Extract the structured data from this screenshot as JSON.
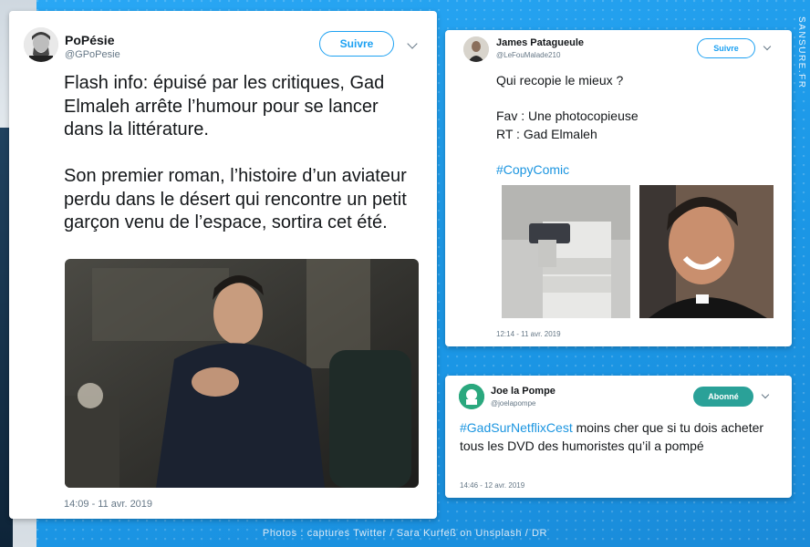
{
  "tweet1": {
    "name": "PoPésie",
    "handle": "@GPoPesie",
    "follow_label": "Suivre",
    "text": "Flash info: épuisé par les critiques, Gad Elmaleh arrête l’humour pour se lancer dans la littérature.\n\nSon premier roman, l’histoire d’un aviateur perdu dans le désert qui rencontre un petit garçon venu de l’espace, sortira cet été.",
    "timestamp": "14:09 - 11 avr. 2019"
  },
  "tweet2": {
    "name": "James Patagueule",
    "handle": "@LeFouMalade210",
    "follow_label": "Suivre",
    "text": "Qui recopie le mieux ?\n\nFav : Une photocopieuse\nRT :  Gad Elmaleh\n\n",
    "hashtag": "#CopyComic",
    "timestamp": "12:14 - 11 avr. 2019"
  },
  "tweet3": {
    "name": "Joe la Pompe",
    "handle": "@joelapompe",
    "follow_label": "Abonné",
    "hashtag": "#GadSurNetflixCest",
    "text": " moins cher que si tu dois acheter tous les DVD des humoristes qu’il a pompé",
    "timestamp": "14:46 - 12 avr. 2019"
  },
  "credit": "Photos : captures Twitter / Sara Kurfeß on Unsplash / DR",
  "watermark": "SANSURE.FR",
  "colors": {
    "twitter_blue": "#1da1f2",
    "followed_green": "#2aa198",
    "background": "#1da1f2"
  }
}
